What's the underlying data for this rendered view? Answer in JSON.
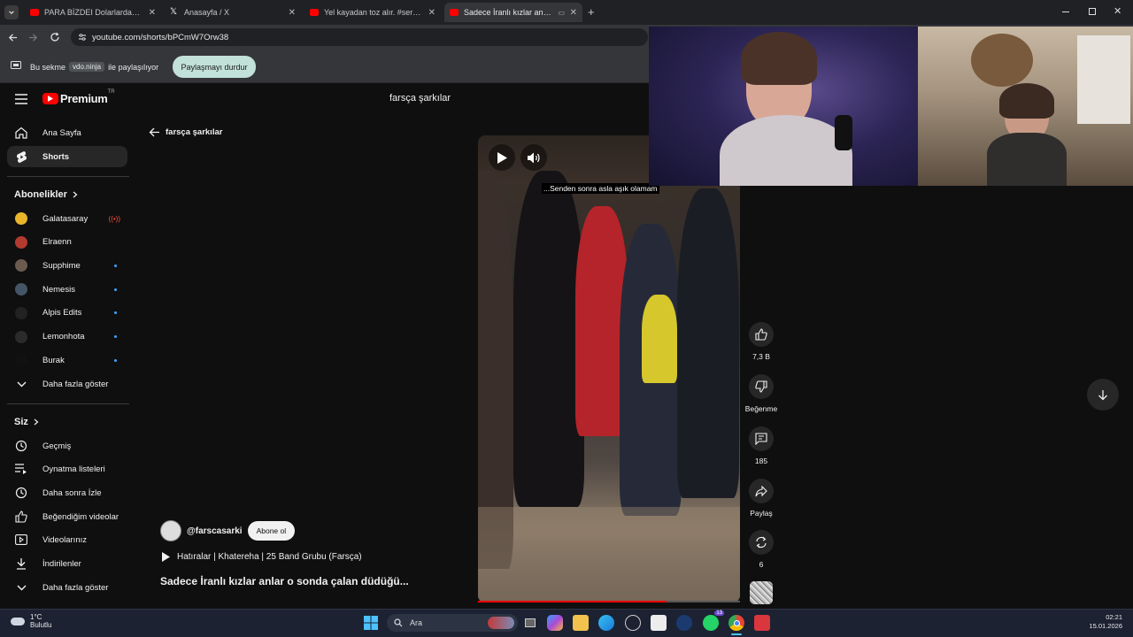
{
  "browser": {
    "tabs": [
      {
        "title": "PARA BİZDEI Dolarlardan Gelin",
        "icon": "youtube-icon",
        "active": false
      },
      {
        "title": "Anasayfa / X",
        "icon": "x-icon",
        "active": false
      },
      {
        "title": "Yel kayadan toz alır. #serdarlig",
        "icon": "youtube-icon",
        "active": false
      },
      {
        "title": "Sadece İranlı kızlar anlar o",
        "icon": "youtube-icon",
        "active": true
      }
    ],
    "new_tab_label": "+",
    "url": "youtube.com/shorts/bPCmW7Orw38",
    "share_bar": {
      "prefix": "Bu sekme",
      "host": "vdo.ninja",
      "suffix": "ile paylaşılıyor",
      "stop_label": "Paylaşmayı durdur"
    }
  },
  "youtube": {
    "logo_text": "Premium",
    "logo_badge": "TR",
    "search_query": "farsça şarkılar",
    "sidebar": {
      "main": [
        {
          "label": "Ana Sayfa",
          "icon": "home-icon",
          "active": false
        },
        {
          "label": "Shorts",
          "icon": "shorts-icon",
          "active": true
        }
      ],
      "subscriptions_heading": "Abonelikler",
      "subscriptions": [
        {
          "label": "Galatasaray",
          "color": "#e8b52b",
          "status": "live"
        },
        {
          "label": "Elraenn",
          "color": "#b23a2f",
          "status": "none"
        },
        {
          "label": "Supphime",
          "color": "#6b5a4e",
          "status": "new"
        },
        {
          "label": "Nemesis",
          "color": "#445566",
          "status": "new"
        },
        {
          "label": "Alpis Edits",
          "color": "#222222",
          "status": "new"
        },
        {
          "label": "Lemonhota",
          "color": "#2b2b2b",
          "status": "new"
        },
        {
          "label": "Burak",
          "color": "#111111",
          "status": "new"
        }
      ],
      "show_more_subs": "Daha fazla göster",
      "you_heading": "Siz",
      "you_items": [
        {
          "label": "Geçmiş",
          "icon": "history-icon"
        },
        {
          "label": "Oynatma listeleri",
          "icon": "playlist-icon"
        },
        {
          "label": "Daha sonra İzle",
          "icon": "watch-later-icon"
        },
        {
          "label": "Beğendiğim videolar",
          "icon": "liked-icon"
        },
        {
          "label": "Videolarınız",
          "icon": "your-videos-icon"
        },
        {
          "label": "İndirilenler",
          "icon": "download-icon"
        }
      ],
      "show_more_you": "Daha fazla göster"
    },
    "back_label": "farsça şarkılar",
    "short": {
      "caption": "...Senden sonra asla aşık olamam",
      "progress": 0.72,
      "channel": "@farscasarki",
      "subscribe_label": "Abone ol",
      "music": "Hatıralar | Khatereha | 25 Band Grubu (Farsça)",
      "title": "Sadece İranlı kızlar anlar o sonda çalan düdüğü..."
    },
    "actions": [
      {
        "icon": "like-icon",
        "label": "7,3 B"
      },
      {
        "icon": "dislike-icon",
        "label": "Beğenme"
      },
      {
        "icon": "comment-icon",
        "label": "185"
      },
      {
        "icon": "share-icon",
        "label": "Paylaş"
      },
      {
        "icon": "remix-icon",
        "label": "6"
      }
    ]
  },
  "taskbar": {
    "weather_temp": "1°C",
    "weather_desc": "Bulutlu",
    "search_placeholder": "Ara",
    "time": "02:21",
    "date": "15.01.2026",
    "whatsapp_badge": "13"
  },
  "colors": {
    "accent": "#ff0000",
    "bg": "#0f0f0f",
    "share_button": "#c2e1d9"
  }
}
